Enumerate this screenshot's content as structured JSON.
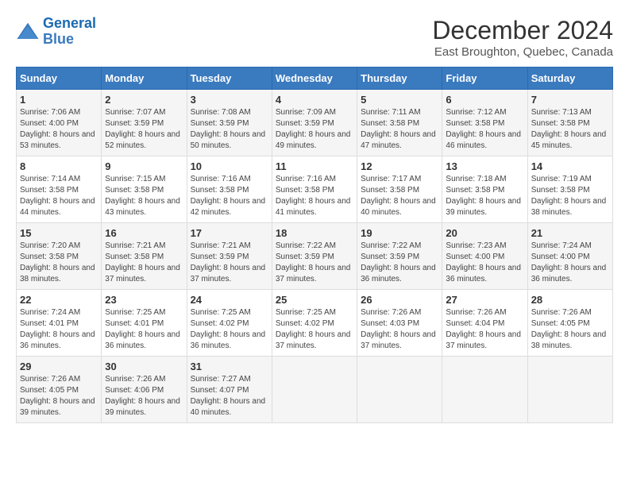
{
  "header": {
    "logo_line1": "General",
    "logo_line2": "Blue",
    "title": "December 2024",
    "subtitle": "East Broughton, Quebec, Canada"
  },
  "calendar": {
    "headers": [
      "Sunday",
      "Monday",
      "Tuesday",
      "Wednesday",
      "Thursday",
      "Friday",
      "Saturday"
    ],
    "weeks": [
      [
        null,
        null,
        null,
        null,
        null,
        null,
        null
      ]
    ],
    "days": [
      {
        "num": "1",
        "sunrise": "Sunrise: 7:06 AM",
        "sunset": "Sunset: 4:00 PM",
        "daylight": "Daylight: 8 hours and 53 minutes."
      },
      {
        "num": "2",
        "sunrise": "Sunrise: 7:07 AM",
        "sunset": "Sunset: 3:59 PM",
        "daylight": "Daylight: 8 hours and 52 minutes."
      },
      {
        "num": "3",
        "sunrise": "Sunrise: 7:08 AM",
        "sunset": "Sunset: 3:59 PM",
        "daylight": "Daylight: 8 hours and 50 minutes."
      },
      {
        "num": "4",
        "sunrise": "Sunrise: 7:09 AM",
        "sunset": "Sunset: 3:59 PM",
        "daylight": "Daylight: 8 hours and 49 minutes."
      },
      {
        "num": "5",
        "sunrise": "Sunrise: 7:11 AM",
        "sunset": "Sunset: 3:58 PM",
        "daylight": "Daylight: 8 hours and 47 minutes."
      },
      {
        "num": "6",
        "sunrise": "Sunrise: 7:12 AM",
        "sunset": "Sunset: 3:58 PM",
        "daylight": "Daylight: 8 hours and 46 minutes."
      },
      {
        "num": "7",
        "sunrise": "Sunrise: 7:13 AM",
        "sunset": "Sunset: 3:58 PM",
        "daylight": "Daylight: 8 hours and 45 minutes."
      },
      {
        "num": "8",
        "sunrise": "Sunrise: 7:14 AM",
        "sunset": "Sunset: 3:58 PM",
        "daylight": "Daylight: 8 hours and 44 minutes."
      },
      {
        "num": "9",
        "sunrise": "Sunrise: 7:15 AM",
        "sunset": "Sunset: 3:58 PM",
        "daylight": "Daylight: 8 hours and 43 minutes."
      },
      {
        "num": "10",
        "sunrise": "Sunrise: 7:16 AM",
        "sunset": "Sunset: 3:58 PM",
        "daylight": "Daylight: 8 hours and 42 minutes."
      },
      {
        "num": "11",
        "sunrise": "Sunrise: 7:16 AM",
        "sunset": "Sunset: 3:58 PM",
        "daylight": "Daylight: 8 hours and 41 minutes."
      },
      {
        "num": "12",
        "sunrise": "Sunrise: 7:17 AM",
        "sunset": "Sunset: 3:58 PM",
        "daylight": "Daylight: 8 hours and 40 minutes."
      },
      {
        "num": "13",
        "sunrise": "Sunrise: 7:18 AM",
        "sunset": "Sunset: 3:58 PM",
        "daylight": "Daylight: 8 hours and 39 minutes."
      },
      {
        "num": "14",
        "sunrise": "Sunrise: 7:19 AM",
        "sunset": "Sunset: 3:58 PM",
        "daylight": "Daylight: 8 hours and 38 minutes."
      },
      {
        "num": "15",
        "sunrise": "Sunrise: 7:20 AM",
        "sunset": "Sunset: 3:58 PM",
        "daylight": "Daylight: 8 hours and 38 minutes."
      },
      {
        "num": "16",
        "sunrise": "Sunrise: 7:21 AM",
        "sunset": "Sunset: 3:58 PM",
        "daylight": "Daylight: 8 hours and 37 minutes."
      },
      {
        "num": "17",
        "sunrise": "Sunrise: 7:21 AM",
        "sunset": "Sunset: 3:59 PM",
        "daylight": "Daylight: 8 hours and 37 minutes."
      },
      {
        "num": "18",
        "sunrise": "Sunrise: 7:22 AM",
        "sunset": "Sunset: 3:59 PM",
        "daylight": "Daylight: 8 hours and 37 minutes."
      },
      {
        "num": "19",
        "sunrise": "Sunrise: 7:22 AM",
        "sunset": "Sunset: 3:59 PM",
        "daylight": "Daylight: 8 hours and 36 minutes."
      },
      {
        "num": "20",
        "sunrise": "Sunrise: 7:23 AM",
        "sunset": "Sunset: 4:00 PM",
        "daylight": "Daylight: 8 hours and 36 minutes."
      },
      {
        "num": "21",
        "sunrise": "Sunrise: 7:24 AM",
        "sunset": "Sunset: 4:00 PM",
        "daylight": "Daylight: 8 hours and 36 minutes."
      },
      {
        "num": "22",
        "sunrise": "Sunrise: 7:24 AM",
        "sunset": "Sunset: 4:01 PM",
        "daylight": "Daylight: 8 hours and 36 minutes."
      },
      {
        "num": "23",
        "sunrise": "Sunrise: 7:25 AM",
        "sunset": "Sunset: 4:01 PM",
        "daylight": "Daylight: 8 hours and 36 minutes."
      },
      {
        "num": "24",
        "sunrise": "Sunrise: 7:25 AM",
        "sunset": "Sunset: 4:02 PM",
        "daylight": "Daylight: 8 hours and 36 minutes."
      },
      {
        "num": "25",
        "sunrise": "Sunrise: 7:25 AM",
        "sunset": "Sunset: 4:02 PM",
        "daylight": "Daylight: 8 hours and 37 minutes."
      },
      {
        "num": "26",
        "sunrise": "Sunrise: 7:26 AM",
        "sunset": "Sunset: 4:03 PM",
        "daylight": "Daylight: 8 hours and 37 minutes."
      },
      {
        "num": "27",
        "sunrise": "Sunrise: 7:26 AM",
        "sunset": "Sunset: 4:04 PM",
        "daylight": "Daylight: 8 hours and 37 minutes."
      },
      {
        "num": "28",
        "sunrise": "Sunrise: 7:26 AM",
        "sunset": "Sunset: 4:05 PM",
        "daylight": "Daylight: 8 hours and 38 minutes."
      },
      {
        "num": "29",
        "sunrise": "Sunrise: 7:26 AM",
        "sunset": "Sunset: 4:05 PM",
        "daylight": "Daylight: 8 hours and 39 minutes."
      },
      {
        "num": "30",
        "sunrise": "Sunrise: 7:26 AM",
        "sunset": "Sunset: 4:06 PM",
        "daylight": "Daylight: 8 hours and 39 minutes."
      },
      {
        "num": "31",
        "sunrise": "Sunrise: 7:27 AM",
        "sunset": "Sunset: 4:07 PM",
        "daylight": "Daylight: 8 hours and 40 minutes."
      }
    ]
  }
}
